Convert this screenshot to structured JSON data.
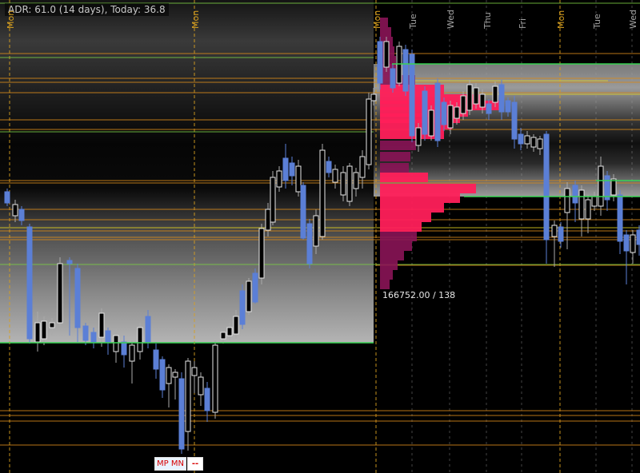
{
  "hud": {
    "text": "ADR: 61.0 (14 days), Today: 36.8"
  },
  "colors": {
    "background": "#000000",
    "profile_band_light": "#b0b0b0",
    "profile_band_dark": "#141414",
    "value_area_edge": "#39d353",
    "level_line_orange": "#d88a1a",
    "level_line_yellow": "#e0d020",
    "level_line_green": "#7acc44",
    "bull_candle": "#5b7fd6",
    "bear_candle": "#e8e8e8",
    "volume_hot": "#ff1f5a",
    "volume_cold": "#8a1456",
    "week_label": "#d8a020",
    "day_label": "#a0a0a0"
  },
  "axis": {
    "day_labels": [
      {
        "label": "Mon",
        "week_start": true
      },
      {
        "label": "Mon",
        "week_start": true
      },
      {
        "label": "Mon",
        "week_start": true
      },
      {
        "label": "Tue",
        "week_start": false
      },
      {
        "label": "Wed",
        "week_start": false
      },
      {
        "label": "Thu",
        "week_start": false
      },
      {
        "label": "Fri",
        "week_start": false
      },
      {
        "label": "Mon",
        "week_start": true
      },
      {
        "label": "Tue",
        "week_start": false
      },
      {
        "label": "Wed",
        "week_start": false
      }
    ]
  },
  "volume_profile": {
    "label": "166752.00 / 138"
  },
  "toolbar": {
    "mp_label": "MP MN",
    "collapse_label": "--"
  }
}
